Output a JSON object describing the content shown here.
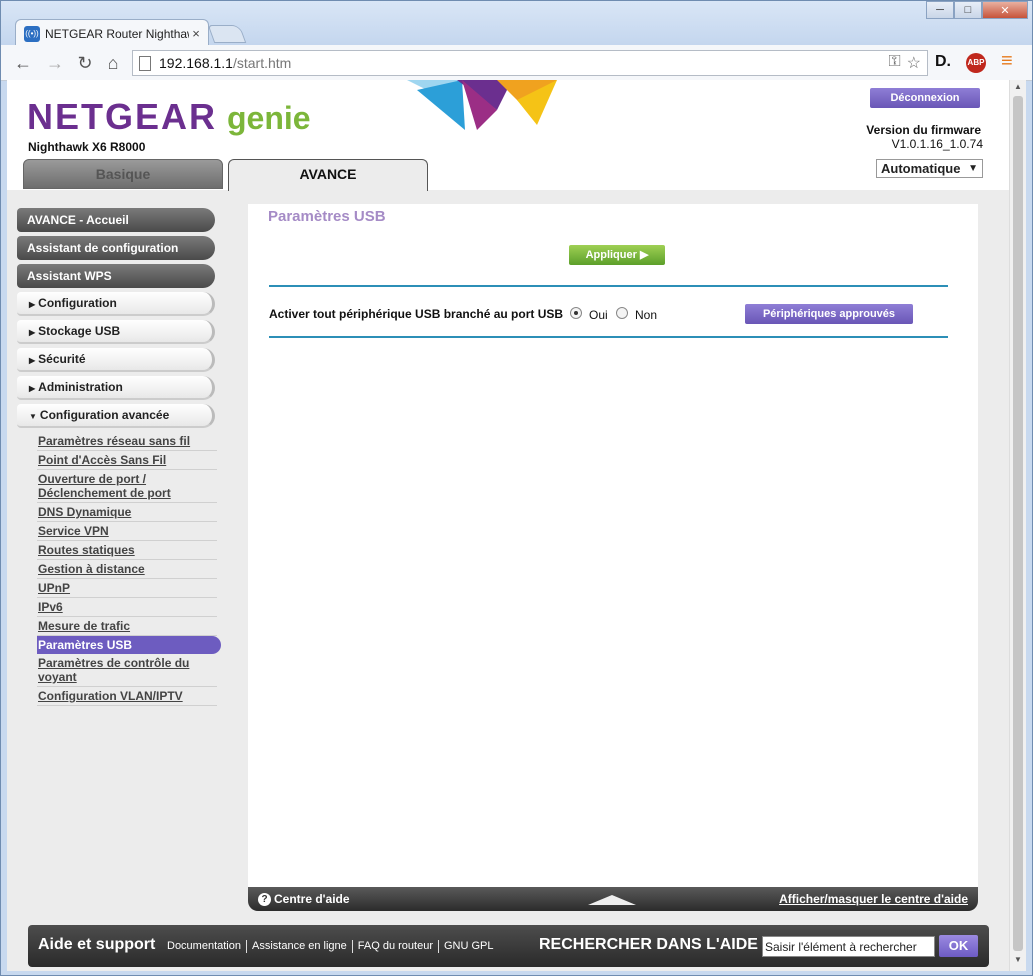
{
  "browser": {
    "tab_title": "NETGEAR Router Nighthawk",
    "tab_close": "×",
    "url_host": "192.168.1.1",
    "url_path": "/start.htm",
    "win_min": "─",
    "win_max": "□",
    "win_close": "✕",
    "back": "←",
    "forward": "→",
    "reload": "↻",
    "home": "⌂",
    "key_icon": "⚿",
    "star_icon": "☆",
    "ext_d": "D.",
    "ext_abp": "ABP",
    "menu_icon": "≡"
  },
  "header": {
    "logo": "NETGEAR",
    "logo_suffix": "genie",
    "model": "Nighthawk X6 R8000",
    "logout_label": "Déconnexion",
    "firmware_label": "Version du firmware",
    "firmware_value": "V1.0.1.16_1.0.74",
    "language_value": "Automatique",
    "language_arrow": "▼",
    "tab_basic": "Basique",
    "tab_advanced": "AVANCE"
  },
  "sidebar": {
    "main_items": [
      "AVANCE - Accueil",
      "Assistant de configuration",
      "Assistant WPS"
    ],
    "collapsible": [
      {
        "label": "Configuration",
        "arrow": "▶"
      },
      {
        "label": "Stockage USB",
        "arrow": "▶"
      },
      {
        "label": "Sécurité",
        "arrow": "▶"
      },
      {
        "label": "Administration",
        "arrow": "▶"
      },
      {
        "label": "Configuration avancée",
        "arrow": "▼"
      }
    ],
    "sub_items": [
      "Paramètres réseau sans fil",
      "Point d'Accès Sans Fil",
      "Ouverture de port / Déclenchement de port",
      "DNS Dynamique",
      "Service VPN",
      "Routes statiques",
      "Gestion à distance",
      "UPnP",
      "IPv6",
      "Mesure de trafic",
      "Paramètres USB",
      "Paramètres de contrôle du voyant",
      "Configuration VLAN/IPTV"
    ],
    "active_sub_index": 10
  },
  "main": {
    "title": "Paramètres USB",
    "apply_label": "Appliquer ▶",
    "usb_label": "Activer tout périphérique USB branché au port USB",
    "option_yes": "Oui",
    "option_no": "Non",
    "selected": "Oui",
    "approved_label": "Périphériques approuvés"
  },
  "helpbar": {
    "left": "Centre d'aide",
    "left_icon": "?",
    "right": "Afficher/masquer le centre d'aide"
  },
  "footer": {
    "title": "Aide et support",
    "links": [
      "Documentation",
      "Assistance en ligne",
      "FAQ du routeur",
      "GNU GPL"
    ],
    "search_title": "RECHERCHER DANS L'AIDE",
    "search_placeholder": "Saisir l'élément à rechercher",
    "ok_label": "OK"
  },
  "colors": {
    "brand_purple": "#6b2f8f",
    "genie_green": "#7cb63a",
    "button_purple": "#6956b6",
    "apply_green": "#5c9f2a",
    "rule_blue": "#2c8fb7"
  },
  "scroll": {
    "up": "▲",
    "down": "▼"
  }
}
